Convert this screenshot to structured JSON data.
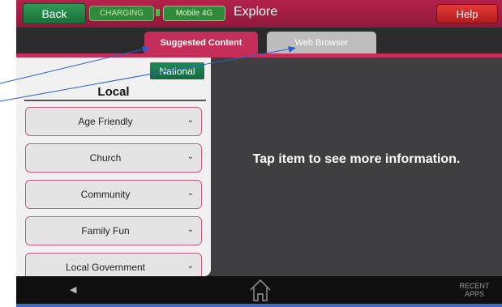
{
  "topbar": {
    "back_label": "Back",
    "charging_label": "CHARGING",
    "mobile_label": "Mobile 4G",
    "title": "Explore",
    "help_label": "Help"
  },
  "tabs": {
    "suggested_label": "Suggested Content",
    "web_label": "Web Browser"
  },
  "left_panel": {
    "national_label": "National",
    "heading": "Local",
    "categories": [
      {
        "label": "Age Friendly"
      },
      {
        "label": "Church"
      },
      {
        "label": "Community"
      },
      {
        "label": "Family Fun"
      },
      {
        "label": "Local Government"
      }
    ]
  },
  "main": {
    "message": "Tap item to see more information."
  },
  "navbar": {
    "recent_line1": "RECENT",
    "recent_line2": "APPS"
  },
  "colors": {
    "header": "#b3224a",
    "accent_tab": "#c42e58",
    "green_button": "#1f8b57",
    "help_button": "#d12b2a",
    "nav_stripe": "#3a6cc2"
  }
}
